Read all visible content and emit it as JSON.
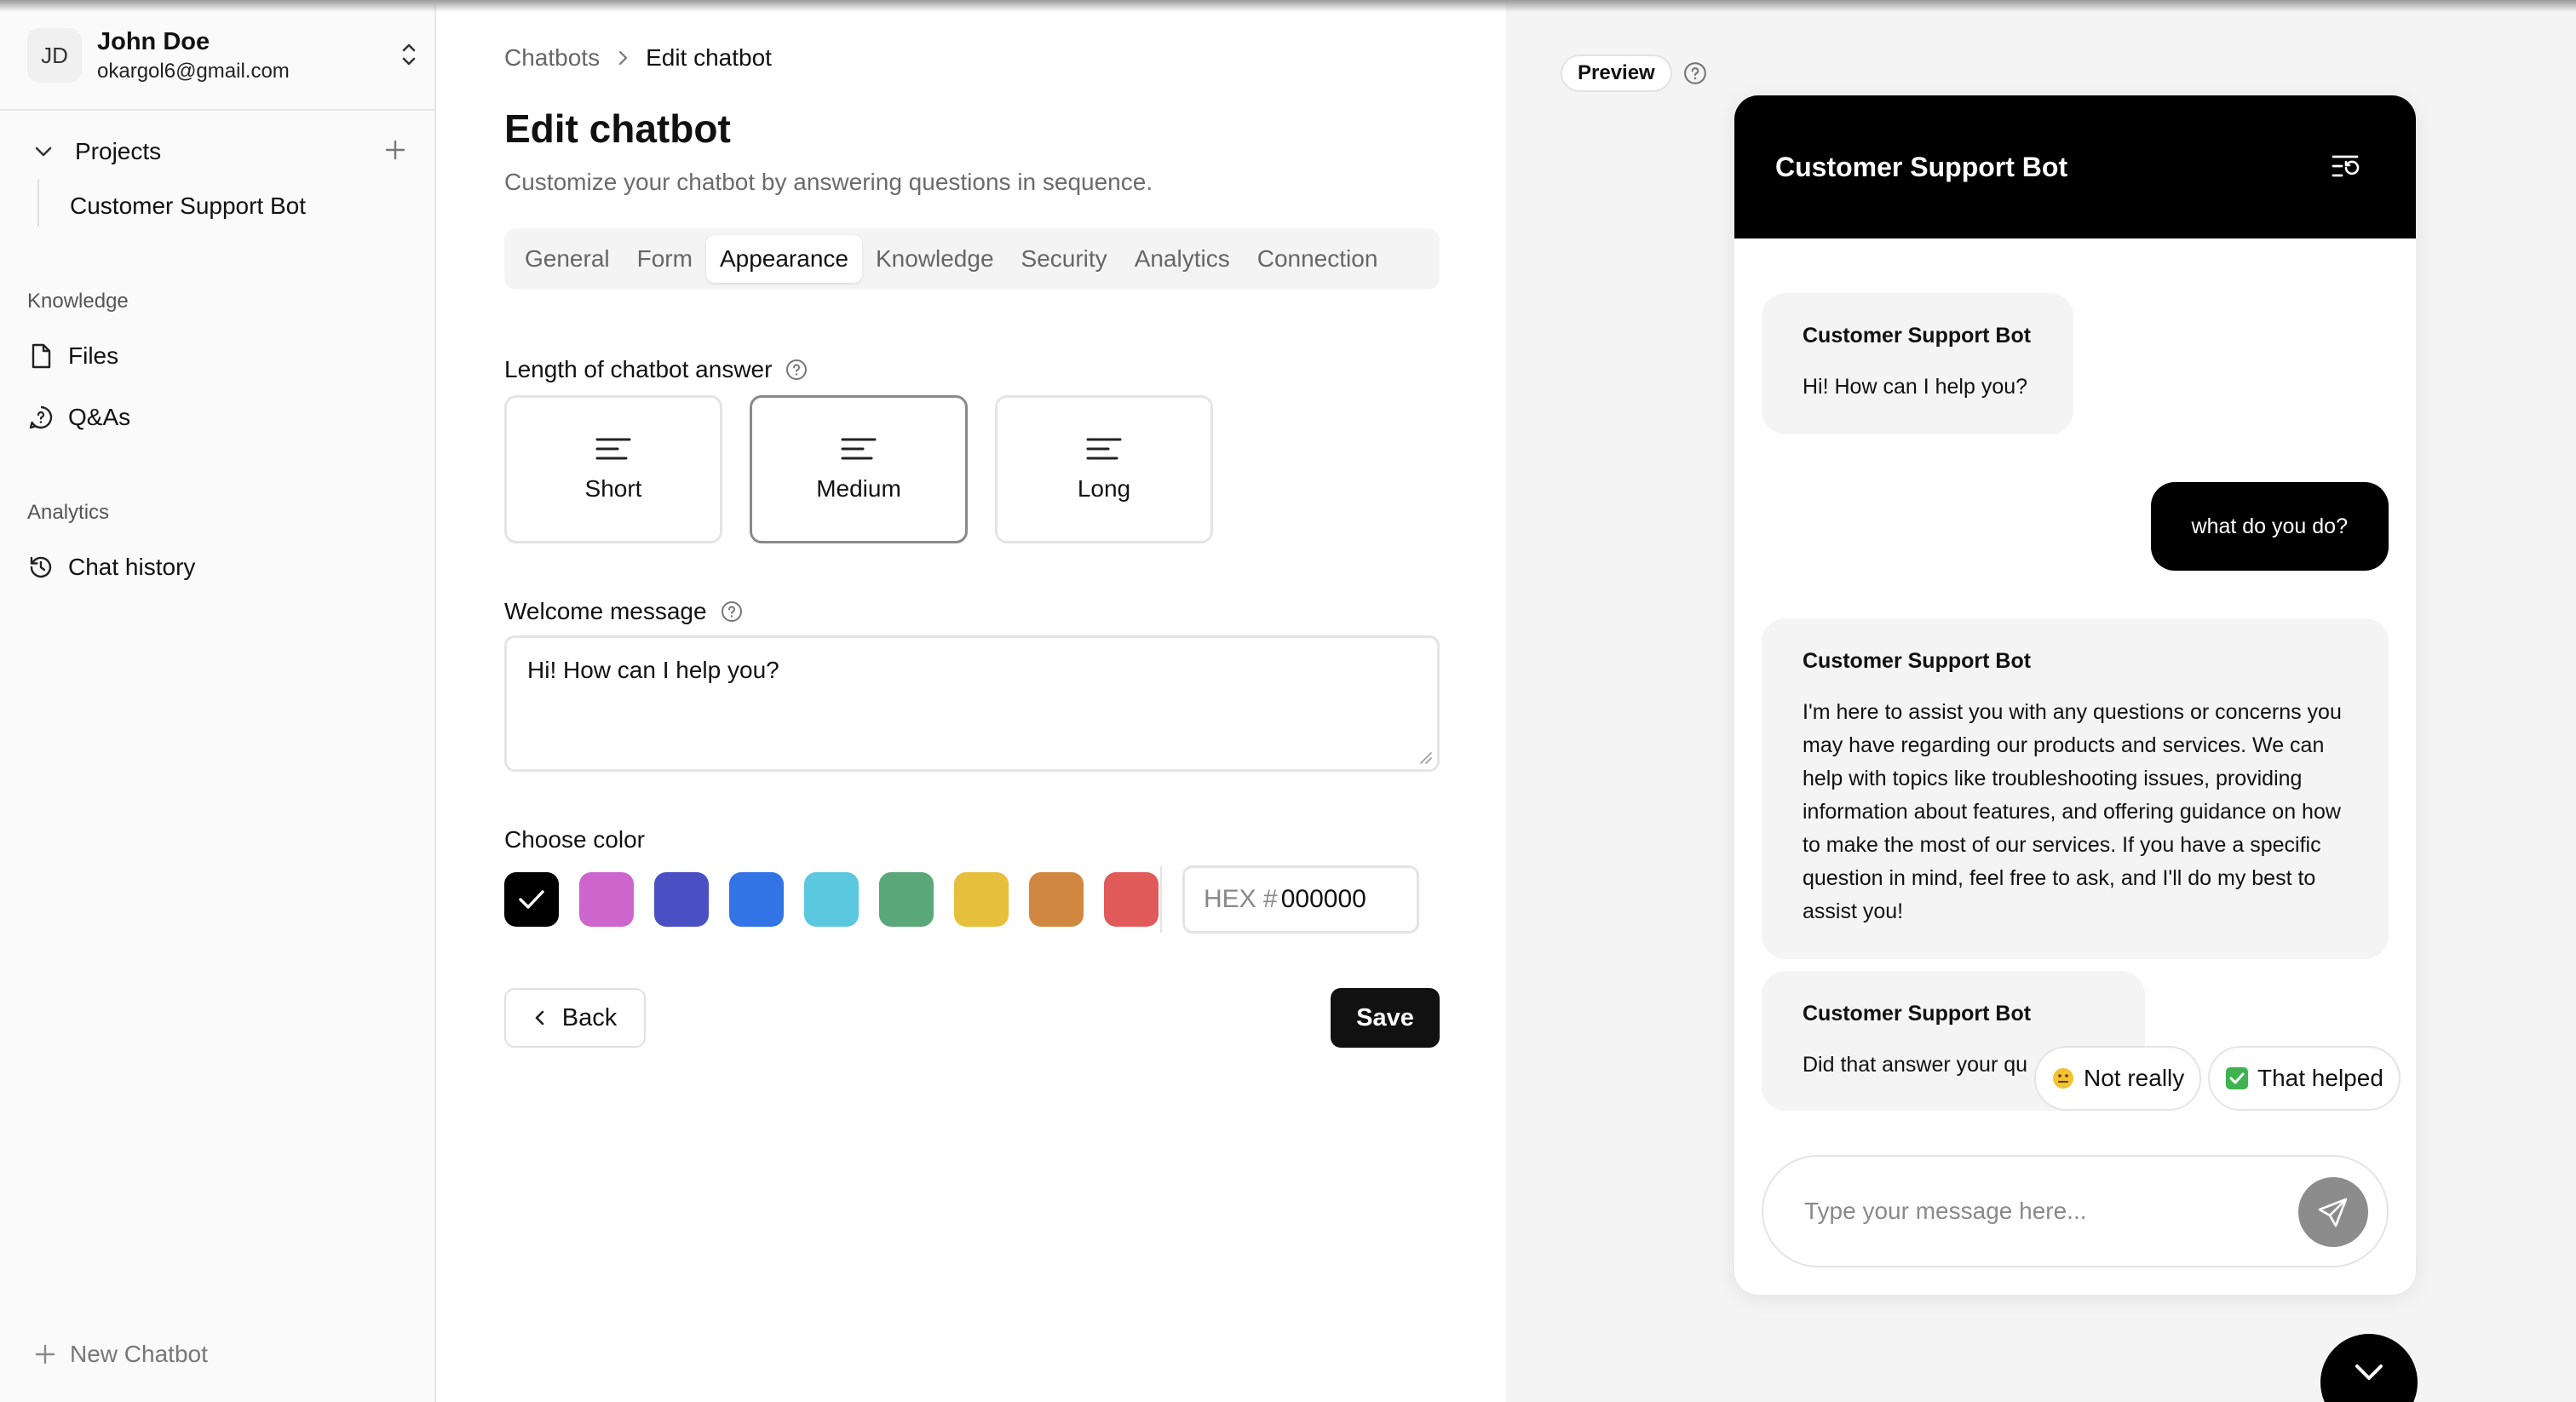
{
  "user": {
    "initials": "JD",
    "name": "John Doe",
    "email": "okargol6@gmail.com"
  },
  "sidebar": {
    "projects_label": "Projects",
    "project_item": "Customer Support Bot",
    "knowledge_label": "Knowledge",
    "files_label": "Files",
    "qas_label": "Q&As",
    "analytics_label": "Analytics",
    "chat_history_label": "Chat history",
    "new_chatbot_label": "New Chatbot"
  },
  "breadcrumb": {
    "parent": "Chatbots",
    "current": "Edit chatbot"
  },
  "page": {
    "title": "Edit chatbot",
    "subtitle": "Customize your chatbot by answering questions in sequence."
  },
  "tabs": [
    {
      "label": "General",
      "active": false
    },
    {
      "label": "Form",
      "active": false
    },
    {
      "label": "Appearance",
      "active": true
    },
    {
      "label": "Knowledge",
      "active": false
    },
    {
      "label": "Security",
      "active": false
    },
    {
      "label": "Analytics",
      "active": false
    },
    {
      "label": "Connection",
      "active": false
    }
  ],
  "length": {
    "label": "Length of chatbot answer",
    "options": [
      {
        "label": "Short",
        "selected": false
      },
      {
        "label": "Medium",
        "selected": true
      },
      {
        "label": "Long",
        "selected": false
      }
    ]
  },
  "welcome": {
    "label": "Welcome message",
    "value": "Hi! How can I help you?"
  },
  "color": {
    "label": "Choose color",
    "swatches": [
      "#000000",
      "#cc66cc",
      "#4a4fc4",
      "#3273e6",
      "#5cc8e0",
      "#5aa87a",
      "#e6bf3c",
      "#d08840",
      "#e05a5a"
    ],
    "selected": "#000000",
    "hex_prefix": "HEX #",
    "hex_value": "000000"
  },
  "buttons": {
    "back": "Back",
    "save": "Save"
  },
  "preview": {
    "badge": "Preview",
    "bot_name": "Customer Support Bot",
    "greeting": "Hi! How can I help you?",
    "user_message": "what do you do?",
    "bot_reply": "I'm here to assist you with any questions or concerns you may have regarding our products and services. We can help with topics like troubleshooting issues, providing information about features, and offering guidance on how to make the most of our services. If you have a specific question in mind, feel free to ask, and I'll do my best to assist you!",
    "followup": "Did that answer your qu",
    "feedback_no": "Not really",
    "feedback_yes": "That helped",
    "input_placeholder": "Type your message here..."
  }
}
